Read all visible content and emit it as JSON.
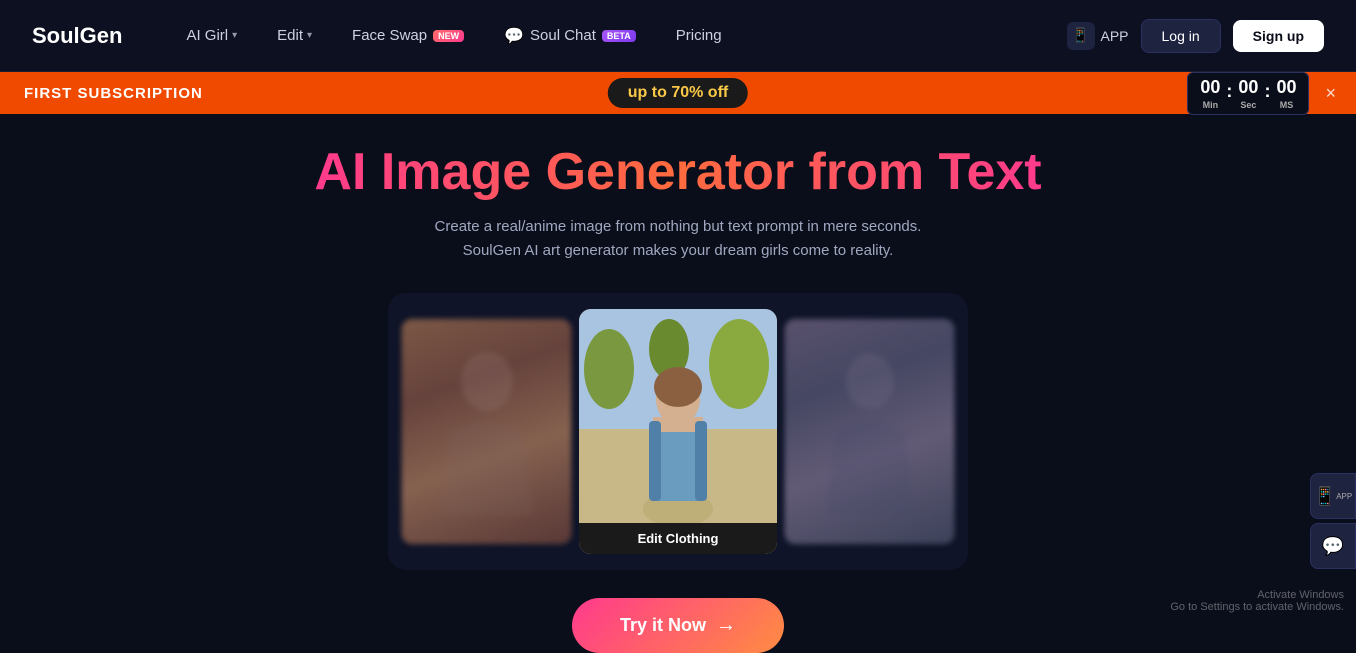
{
  "logo": {
    "text": "SoulGen"
  },
  "navbar": {
    "items": [
      {
        "id": "ai-girl",
        "label": "AI Girl",
        "hasDropdown": true,
        "badge": null
      },
      {
        "id": "edit",
        "label": "Edit",
        "hasDropdown": true,
        "badge": null
      },
      {
        "id": "face-swap",
        "label": "Face Swap",
        "hasDropdown": false,
        "badge": "NEW"
      },
      {
        "id": "soul-chat",
        "label": "Soul Chat",
        "hasDropdown": false,
        "badge": "Beta",
        "icon": "💬"
      },
      {
        "id": "pricing",
        "label": "Pricing",
        "hasDropdown": false,
        "badge": null
      }
    ],
    "app_label": "APP",
    "login_label": "Log in",
    "signup_label": "Sign up"
  },
  "promo": {
    "left_text": "FIRST SUBSCRIPTION",
    "center_text": "up to",
    "discount": "70% off",
    "timer": {
      "minutes": "00",
      "seconds": "00",
      "milliseconds": "00",
      "label_min": "Min",
      "label_sec": "Sec",
      "label_ms": "MS"
    },
    "close_label": "×"
  },
  "hero": {
    "title": "AI Image Generator from Text",
    "subtitle_line1": "Create a real/anime image from nothing but text prompt in mere seconds.",
    "subtitle_line2": "SoulGen AI art generator makes your dream girls come to reality."
  },
  "carousel": {
    "edit_label": "Edit Clothing"
  },
  "cta": {
    "label": "Try it Now",
    "arrow": "→"
  },
  "windows": {
    "title": "Activate Windows",
    "subtitle": "Go to Settings to activate Windows."
  }
}
